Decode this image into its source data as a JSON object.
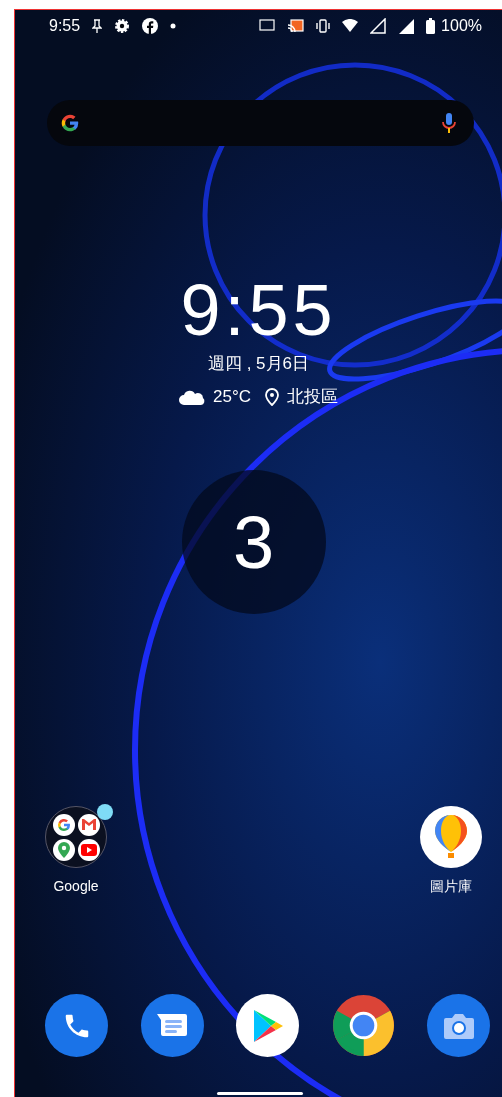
{
  "status_bar": {
    "time": "9:55",
    "battery": "100%"
  },
  "clock": {
    "time": "9:55",
    "date": "週四 , 5月6日",
    "temperature": "25°C",
    "location": "北投區"
  },
  "page_number": "3",
  "home_icons": [
    {
      "kind": "folder",
      "label": "Google",
      "badge": true
    },
    {
      "kind": "gallery",
      "label": "圖片庫"
    }
  ],
  "dock": [
    {
      "kind": "phone"
    },
    {
      "kind": "messages"
    },
    {
      "kind": "play"
    },
    {
      "kind": "chrome"
    },
    {
      "kind": "camera"
    }
  ]
}
